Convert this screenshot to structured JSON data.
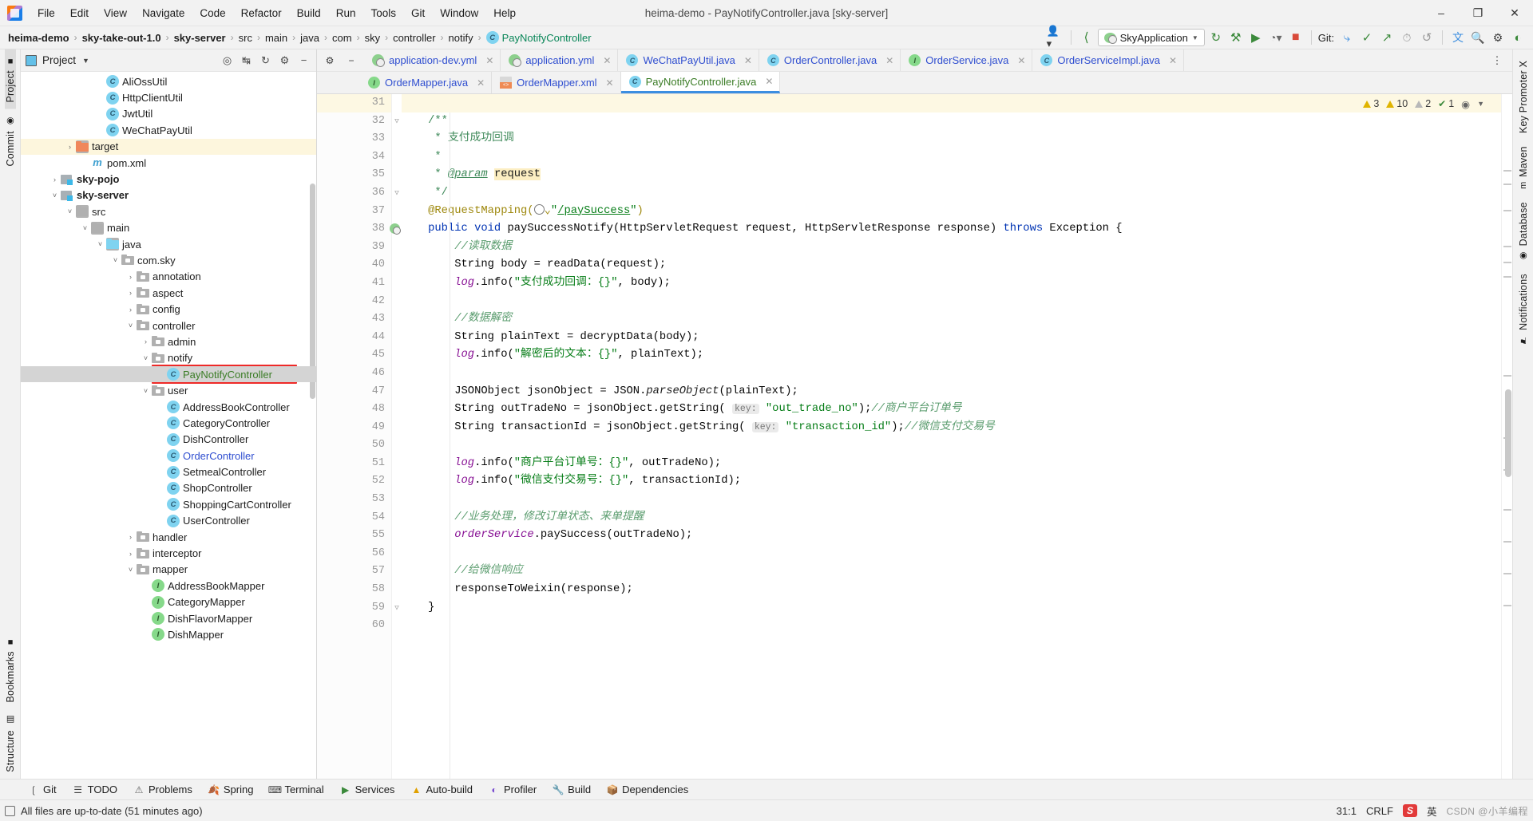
{
  "window": {
    "title": "heima-demo - PayNotifyController.java [sky-server]",
    "minimize": "–",
    "maximize": "❐",
    "close": "✕"
  },
  "menubar": [
    {
      "label": "File"
    },
    {
      "label": "Edit"
    },
    {
      "label": "View"
    },
    {
      "label": "Navigate"
    },
    {
      "label": "Code"
    },
    {
      "label": "Refactor"
    },
    {
      "label": "Build"
    },
    {
      "label": "Run"
    },
    {
      "label": "Tools"
    },
    {
      "label": "Git"
    },
    {
      "label": "Window"
    },
    {
      "label": "Help"
    }
  ],
  "breadcrumbs": [
    {
      "label": "heima-demo",
      "style": "bold"
    },
    {
      "label": "sky-take-out-1.0",
      "style": "bold"
    },
    {
      "label": "sky-server",
      "style": "bold"
    },
    {
      "label": "src",
      "style": "normal"
    },
    {
      "label": "main",
      "style": "normal"
    },
    {
      "label": "java",
      "style": "normal"
    },
    {
      "label": "com",
      "style": "normal"
    },
    {
      "label": "sky",
      "style": "normal"
    },
    {
      "label": "controller",
      "style": "normal"
    },
    {
      "label": "notify",
      "style": "normal"
    },
    {
      "label": "PayNotifyController",
      "style": "green"
    }
  ],
  "toolbar": {
    "run_configuration": "SkyApplication",
    "git_label": "Git:",
    "icons": [
      "profiler-icon",
      "back-arrow-icon",
      "build-icon",
      "run-icon",
      "debug-icon",
      "coverage-icon",
      "stop-icon",
      "git-update-icon",
      "git-commit-icon",
      "git-push-icon",
      "git-history-icon",
      "git-rollback-icon",
      "translate-icon",
      "search-icon",
      "settings-icon",
      "ai-assistant-icon"
    ]
  },
  "left_tool_tabs": [
    {
      "label": "Project",
      "active": true
    },
    {
      "label": "Commit",
      "active": false
    },
    {
      "label": "Bookmarks",
      "active": false
    },
    {
      "label": "Structure",
      "active": false
    }
  ],
  "right_tool_tabs": [
    {
      "label": "Key Promoter X"
    },
    {
      "label": "Maven"
    },
    {
      "label": "Database"
    },
    {
      "label": "Notifications"
    }
  ],
  "project_panel": {
    "title": "Project",
    "actions": [
      "locate-icon",
      "expand-all-icon",
      "collapse-all-icon",
      "settings-icon",
      "hide-icon"
    ],
    "tree": [
      {
        "depth": 5,
        "label": "AliOssUtil",
        "icon": "class",
        "arrow": "",
        "style": "normal",
        "highlight": "none"
      },
      {
        "depth": 5,
        "label": "HttpClientUtil",
        "icon": "class",
        "arrow": "",
        "style": "normal",
        "highlight": "none"
      },
      {
        "depth": 5,
        "label": "JwtUtil",
        "icon": "class",
        "arrow": "",
        "style": "normal",
        "highlight": "none"
      },
      {
        "depth": 5,
        "label": "WeChatPayUtil",
        "icon": "class",
        "arrow": "",
        "style": "normal",
        "highlight": "none"
      },
      {
        "depth": 3,
        "label": "target",
        "icon": "folder-orange",
        "arrow": "right",
        "style": "normal",
        "highlight": "yellow"
      },
      {
        "depth": 4,
        "label": "pom.xml",
        "icon": "maven",
        "arrow": "",
        "style": "normal",
        "highlight": "none"
      },
      {
        "depth": 2,
        "label": "sky-pojo",
        "icon": "module",
        "arrow": "right",
        "style": "bold",
        "highlight": "none"
      },
      {
        "depth": 2,
        "label": "sky-server",
        "icon": "module",
        "arrow": "down",
        "style": "bold",
        "highlight": "none"
      },
      {
        "depth": 3,
        "label": "src",
        "icon": "folder",
        "arrow": "down",
        "style": "normal",
        "highlight": "none"
      },
      {
        "depth": 4,
        "label": "main",
        "icon": "folder",
        "arrow": "down",
        "style": "normal",
        "highlight": "none"
      },
      {
        "depth": 5,
        "label": "java",
        "icon": "folder-blue",
        "arrow": "down",
        "style": "normal",
        "highlight": "none"
      },
      {
        "depth": 6,
        "label": "com.sky",
        "icon": "package",
        "arrow": "down",
        "style": "normal",
        "highlight": "none"
      },
      {
        "depth": 7,
        "label": "annotation",
        "icon": "package",
        "arrow": "right",
        "style": "normal",
        "highlight": "none"
      },
      {
        "depth": 7,
        "label": "aspect",
        "icon": "package",
        "arrow": "right",
        "style": "normal",
        "highlight": "none"
      },
      {
        "depth": 7,
        "label": "config",
        "icon": "package",
        "arrow": "right",
        "style": "normal",
        "highlight": "none"
      },
      {
        "depth": 7,
        "label": "controller",
        "icon": "package",
        "arrow": "down",
        "style": "normal",
        "highlight": "none"
      },
      {
        "depth": 8,
        "label": "admin",
        "icon": "package",
        "arrow": "right",
        "style": "normal",
        "highlight": "none"
      },
      {
        "depth": 8,
        "label": "notify",
        "icon": "package",
        "arrow": "down",
        "style": "normal",
        "highlight": "none"
      },
      {
        "depth": 9,
        "label": "PayNotifyController",
        "icon": "class",
        "arrow": "",
        "style": "green",
        "highlight": "grey"
      },
      {
        "depth": 8,
        "label": "user",
        "icon": "package",
        "arrow": "down",
        "style": "normal",
        "highlight": "none"
      },
      {
        "depth": 9,
        "label": "AddressBookController",
        "icon": "class",
        "arrow": "",
        "style": "normal",
        "highlight": "none"
      },
      {
        "depth": 9,
        "label": "CategoryController",
        "icon": "class",
        "arrow": "",
        "style": "normal",
        "highlight": "none"
      },
      {
        "depth": 9,
        "label": "DishController",
        "icon": "class",
        "arrow": "",
        "style": "normal",
        "highlight": "none"
      },
      {
        "depth": 9,
        "label": "OrderController",
        "icon": "class",
        "arrow": "",
        "style": "blue",
        "highlight": "none"
      },
      {
        "depth": 9,
        "label": "SetmealController",
        "icon": "class",
        "arrow": "",
        "style": "normal",
        "highlight": "none"
      },
      {
        "depth": 9,
        "label": "ShopController",
        "icon": "class",
        "arrow": "",
        "style": "normal",
        "highlight": "none"
      },
      {
        "depth": 9,
        "label": "ShoppingCartController",
        "icon": "class",
        "arrow": "",
        "style": "normal",
        "highlight": "none"
      },
      {
        "depth": 9,
        "label": "UserController",
        "icon": "class",
        "arrow": "",
        "style": "normal",
        "highlight": "none"
      },
      {
        "depth": 7,
        "label": "handler",
        "icon": "package",
        "arrow": "right",
        "style": "normal",
        "highlight": "none"
      },
      {
        "depth": 7,
        "label": "interceptor",
        "icon": "package",
        "arrow": "right",
        "style": "normal",
        "highlight": "none"
      },
      {
        "depth": 7,
        "label": "mapper",
        "icon": "package",
        "arrow": "down",
        "style": "normal",
        "highlight": "none"
      },
      {
        "depth": 8,
        "label": "AddressBookMapper",
        "icon": "interface",
        "arrow": "",
        "style": "normal",
        "highlight": "none"
      },
      {
        "depth": 8,
        "label": "CategoryMapper",
        "icon": "interface",
        "arrow": "",
        "style": "normal",
        "highlight": "none"
      },
      {
        "depth": 8,
        "label": "DishFlavorMapper",
        "icon": "interface",
        "arrow": "",
        "style": "normal",
        "highlight": "none"
      },
      {
        "depth": 8,
        "label": "DishMapper",
        "icon": "interface",
        "arrow": "",
        "style": "normal",
        "highlight": "none"
      }
    ]
  },
  "editor_tabs_row1": [
    {
      "label": "application-dev.yml",
      "icon": "yml",
      "state": "inactive"
    },
    {
      "label": "application.yml",
      "icon": "yml",
      "state": "inactive"
    },
    {
      "label": "WeChatPayUtil.java",
      "icon": "class",
      "state": "inactive"
    },
    {
      "label": "OrderController.java",
      "icon": "class",
      "state": "inactive"
    },
    {
      "label": "OrderService.java",
      "icon": "interface",
      "state": "inactive"
    },
    {
      "label": "OrderServiceImpl.java",
      "icon": "class",
      "state": "inactive"
    }
  ],
  "editor_tabs_row2": [
    {
      "label": "OrderMapper.java",
      "icon": "interface",
      "state": "inactive"
    },
    {
      "label": "OrderMapper.xml",
      "icon": "xml",
      "state": "inactive"
    },
    {
      "label": "PayNotifyController.java",
      "icon": "class",
      "state": "selected"
    }
  ],
  "inspections": {
    "errors": "3",
    "warnings": "10",
    "weak_warnings": "2",
    "typos": "1"
  },
  "code": {
    "first_line_number": 31,
    "lines": [
      {
        "n": 31,
        "html": "",
        "highlight": true
      },
      {
        "n": 32,
        "html": "<span class='doc'>    /**</span>",
        "fold": "start"
      },
      {
        "n": 33,
        "html": "<span class='doc'>     * 支付成功回调</span>"
      },
      {
        "n": 34,
        "html": "<span class='doc'>     *</span>"
      },
      {
        "n": 35,
        "html": "<span class='doc'>     * </span><span class='docp'>@param</span><span class='doc'> </span><span class='hlbg'>request</span>"
      },
      {
        "n": 36,
        "html": "<span class='doc'>     */</span>",
        "fold": "end"
      },
      {
        "n": 37,
        "html": "<span class='ann'>    @RequestMapping(</span><span class='globe-slot'></span><span class='str'>\"</span><span class='lnk'>/paySuccess</span><span class='str'>\"</span><span class='ann'>)</span>"
      },
      {
        "n": 38,
        "html": "    <span class='kw'>public void</span> <span class='plain'>paySuccessNotify(HttpServletRequest request, HttpServletResponse response) </span><span class='kw'>throws</span><span class='plain'> Exception {</span>",
        "run": true,
        "fold": "start"
      },
      {
        "n": 39,
        "html": "        <span class='cmz'>//读取数据</span>"
      },
      {
        "n": 40,
        "html": "        <span class='plain'>String body = readData(request);</span>"
      },
      {
        "n": 41,
        "html": "        <span class='fld'>log</span><span class='plain'>.info(</span><span class='str'>\"支付成功回调：{}\"</span><span class='plain'>, body);</span>"
      },
      {
        "n": 42,
        "html": ""
      },
      {
        "n": 43,
        "html": "        <span class='cmz'>//数据解密</span>"
      },
      {
        "n": 44,
        "html": "        <span class='plain'>String plainText = decryptData(body);</span>"
      },
      {
        "n": 45,
        "html": "        <span class='fld'>log</span><span class='plain'>.info(</span><span class='str'>\"解密后的文本：{}\"</span><span class='plain'>, plainText);</span>"
      },
      {
        "n": 46,
        "html": ""
      },
      {
        "n": 47,
        "html": "        <span class='plain'>JSONObject jsonObject = JSON.</span><span class='ital'>parseObject</span><span class='plain'>(plainText);</span>"
      },
      {
        "n": 48,
        "html": "        <span class='plain'>String outTradeNo = jsonObject.getString(</span> <span class='hint'>key:</span> <span class='str'>\"out_trade_no\"</span><span class='plain'>);</span><span class='cmz'>//商户平台订单号</span>"
      },
      {
        "n": 49,
        "html": "        <span class='plain'>String transactionId = jsonObject.getString(</span> <span class='hint'>key:</span> <span class='str'>\"transaction_id\"</span><span class='plain'>);</span><span class='cmz'>//微信支付交易号</span>"
      },
      {
        "n": 50,
        "html": ""
      },
      {
        "n": 51,
        "html": "        <span class='fld'>log</span><span class='plain'>.info(</span><span class='str'>\"商户平台订单号：{}\"</span><span class='plain'>, outTradeNo);</span>"
      },
      {
        "n": 52,
        "html": "        <span class='fld'>log</span><span class='plain'>.info(</span><span class='str'>\"微信支付交易号：{}\"</span><span class='plain'>, transactionId);</span>"
      },
      {
        "n": 53,
        "html": ""
      },
      {
        "n": 54,
        "html": "        <span class='cmz'>//业务处理，修改订单状态、来单提醒</span>"
      },
      {
        "n": 55,
        "html": "        <span class='fld'>orderService</span><span class='plain'>.paySuccess(outTradeNo);</span>"
      },
      {
        "n": 56,
        "html": ""
      },
      {
        "n": 57,
        "html": "        <span class='cmz'>//给微信响应</span>"
      },
      {
        "n": 58,
        "html": "        <span class='plain'>responseToWeixin(response);</span>"
      },
      {
        "n": 59,
        "html": "    <span class='plain'>}</span>",
        "fold": "end"
      },
      {
        "n": 60,
        "html": ""
      }
    ]
  },
  "bottom_tools": [
    {
      "label": "Git",
      "icon": "git-icon"
    },
    {
      "label": "TODO",
      "icon": "todo-icon"
    },
    {
      "label": "Problems",
      "icon": "problems-icon"
    },
    {
      "label": "Spring",
      "icon": "spring-icon"
    },
    {
      "label": "Terminal",
      "icon": "terminal-icon"
    },
    {
      "label": "Services",
      "icon": "services-icon"
    },
    {
      "label": "Auto-build",
      "icon": "autobuild-icon"
    },
    {
      "label": "Profiler",
      "icon": "profiler-icon"
    },
    {
      "label": "Build",
      "icon": "build-icon"
    },
    {
      "label": "Dependencies",
      "icon": "dependencies-icon"
    }
  ],
  "statusbar": {
    "message": "All files are up-to-date (51 minutes ago)",
    "caret": "31:1",
    "line_separator": "CRLF",
    "ime_badge": "S",
    "ime_lang": "英",
    "watermark": "CSDN @小羊编程"
  },
  "colors": {
    "accent_blue": "#3c8ee0",
    "selection_grey": "#d4d4d4",
    "highlight_yellow": "#fdf6dd",
    "annotation_box_red": "#ee2a28",
    "string_green": "#067d17",
    "keyword_blue": "#0033b3",
    "comment_green": "#5a9c6e"
  }
}
